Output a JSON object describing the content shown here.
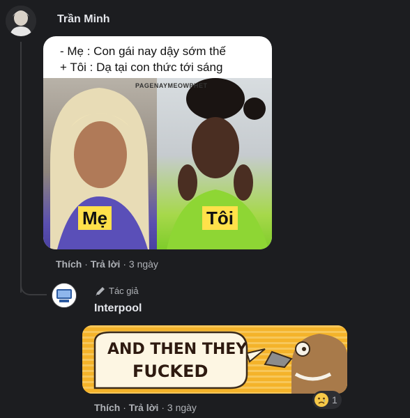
{
  "comment": {
    "author": "Trần Minh",
    "meme": {
      "caption_lines": [
        "- Mẹ : Con gái nay dậy sớm thế",
        "+ Tôi : Dạ tại con thức tới sáng"
      ],
      "watermark": "PAGENAYMEOWPHET",
      "label_left": "Mẹ",
      "label_right": "Tôi"
    },
    "actions": {
      "like": "Thích",
      "reply": "Trả lời",
      "time": "3 ngày"
    }
  },
  "reply": {
    "author_badge": "Tác giả",
    "author": "Interpool",
    "meme_text_line1": "AND THEN THEY",
    "meme_text_line2": "FUCKED",
    "actions": {
      "like": "Thích",
      "reply": "Trả lời",
      "time": "3 ngày"
    },
    "reaction": {
      "icon": "sad-face",
      "count": "1"
    }
  }
}
